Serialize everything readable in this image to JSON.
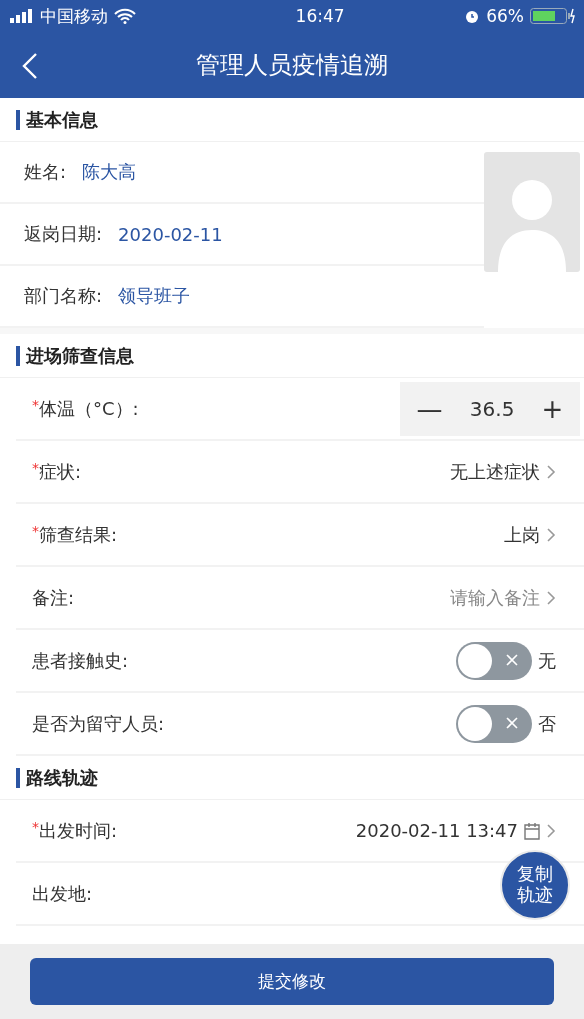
{
  "status_bar": {
    "carrier": "中国移动",
    "time": "16:47",
    "battery": "66%"
  },
  "nav": {
    "title": "管理人员疫情追溯"
  },
  "basic_info": {
    "title": "基本信息",
    "fields": [
      {
        "label": "姓名:",
        "value": "陈大高"
      },
      {
        "label": "返岗日期:",
        "value": "2020-02-11"
      },
      {
        "label": "部门名称:",
        "value": "领导班子"
      }
    ]
  },
  "screening": {
    "title": "进场筛查信息",
    "rows": [
      {
        "kind": "stepper",
        "label": "体温（°C）:",
        "required_mark": "*",
        "minus": "—",
        "value": "36.5",
        "plus": "+"
      },
      {
        "kind": "select",
        "label": "症状:",
        "required_mark": "*",
        "value": "无上述症状"
      },
      {
        "kind": "select",
        "label": "筛查结果:",
        "required_mark": "*",
        "value": "上岗"
      },
      {
        "kind": "select",
        "label": "备注:",
        "placeholder": "请输入备注"
      },
      {
        "kind": "toggle",
        "label": "患者接触史:",
        "on": false,
        "value": "无"
      },
      {
        "kind": "toggle",
        "label": "是否为留守人员:",
        "on": false,
        "value": "否"
      }
    ]
  },
  "route": {
    "title": "路线轨迹",
    "rows": [
      {
        "kind": "datetime",
        "label": "出发时间:",
        "required_mark": "*",
        "value": "2020-02-11 13:47"
      },
      {
        "kind": "select",
        "label": "出发地:"
      }
    ]
  },
  "float_button": "复制轨迹",
  "submit_button": "提交修改"
}
